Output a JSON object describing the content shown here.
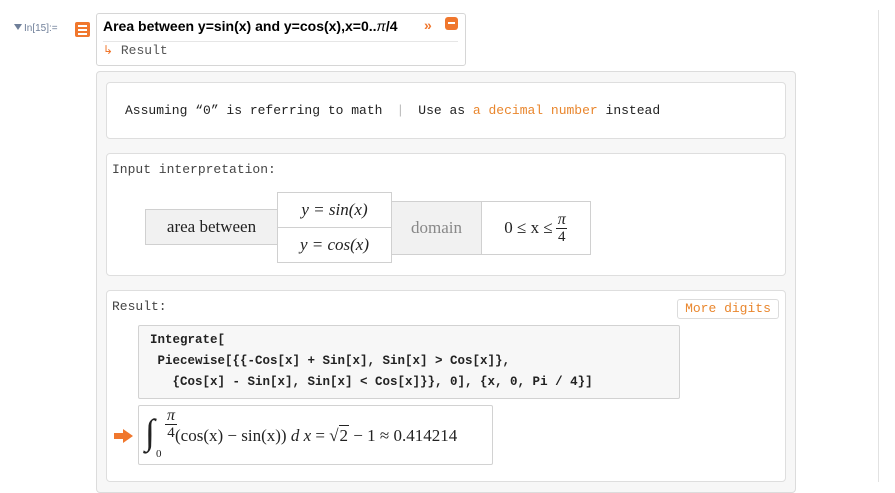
{
  "input_label": "In[15]:=",
  "query": {
    "text": "Area between y=sin(x) and y=cos(x),x=0..",
    "pi": "π",
    "tail": "/4",
    "chevron": "»",
    "result_link": "Result",
    "arrow_icon": "↳"
  },
  "assumption": {
    "text": "Assuming “0” is referring to math",
    "separator": "|",
    "prefix": "Use as",
    "link": "a decimal number",
    "suffix": "instead"
  },
  "input_pod": {
    "title": "Input interpretation:",
    "area_between": "area between",
    "f1": "y = sin(x)",
    "f2": "y = cos(x)",
    "domain_label": "domain",
    "domain_lhs": "0 ≤ x ≤",
    "domain_num": "π",
    "domain_den": "4"
  },
  "result_pod": {
    "title": "Result:",
    "more_digits": "More digits",
    "code_line1": "Integrate[",
    "code_line2": " Piecewise[{{-Cos[x] + Sin[x], Sin[x] > Cos[x]},",
    "code_line3": "   {Cos[x] - Sin[x], Sin[x] < Cos[x]}}, 0], {x, 0, Pi / 4}]",
    "integral_sign": "∫",
    "upper_num": "π",
    "upper_den": "4",
    "lower": "0",
    "integrand": "(cos(x) − sin(x)) ",
    "dx": "d x",
    "eq": " = ",
    "sqrt_sign": "√",
    "sqrt_arg": "2",
    "minus_one": " − 1 ≈ 0.414214"
  },
  "colors": {
    "accent": "#f0772d",
    "link": "#e9862d"
  }
}
